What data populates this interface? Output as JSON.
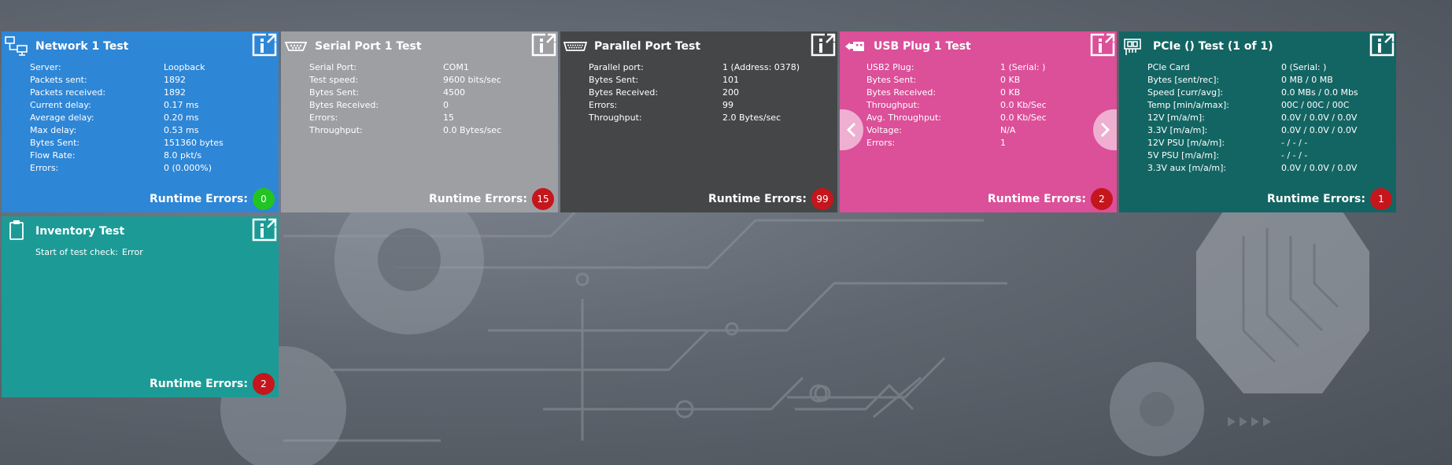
{
  "colors": {
    "network": "#2e86d6",
    "serial": "#9e9fa3",
    "parallel": "#454648",
    "usb": "#dc4f99",
    "pcie": "#136563",
    "inventory": "#1c9b96",
    "badge_green": "#22c421",
    "badge_red": "#c4161c"
  },
  "tiles": {
    "network": {
      "title": "Network 1 Test",
      "icon": "network-computers-icon",
      "rows": [
        {
          "k": "Server:",
          "v": "Loopback"
        },
        {
          "k": "Packets sent:",
          "v": "1892"
        },
        {
          "k": "Packets received:",
          "v": "1892"
        },
        {
          "k": "Current delay:",
          "v": "0.17 ms"
        },
        {
          "k": "Average delay:",
          "v": "0.20 ms"
        },
        {
          "k": "Max delay:",
          "v": "0.53 ms"
        },
        {
          "k": "Bytes Sent:",
          "v": "151360 bytes"
        },
        {
          "k": "Flow Rate:",
          "v": "8.0 pkt/s"
        },
        {
          "k": "Errors:",
          "v": "0 (0.000%)"
        }
      ],
      "runtime_label": "Runtime Errors:",
      "runtime_errors": "0"
    },
    "serial": {
      "title": "Serial Port 1 Test",
      "icon": "serial-port-icon",
      "rows": [
        {
          "k": "Serial Port:",
          "v": "COM1"
        },
        {
          "k": "Test speed:",
          "v": "9600 bits/sec"
        },
        {
          "k": "Bytes Sent:",
          "v": "4500"
        },
        {
          "k": "Bytes Received:",
          "v": "0"
        },
        {
          "k": "Errors:",
          "v": "15"
        },
        {
          "k": "Throughput:",
          "v": "0.0 Bytes/sec"
        }
      ],
      "runtime_label": "Runtime Errors:",
      "runtime_errors": "15"
    },
    "parallel": {
      "title": "Parallel Port Test",
      "icon": "parallel-port-icon",
      "rows": [
        {
          "k": "Parallel port:",
          "v": "1 (Address: 0378)"
        },
        {
          "k": "Bytes Sent:",
          "v": "101"
        },
        {
          "k": "Bytes Received:",
          "v": "200"
        },
        {
          "k": "Errors:",
          "v": "99"
        },
        {
          "k": "Throughput:",
          "v": "2.0 Bytes/sec"
        }
      ],
      "runtime_label": "Runtime Errors:",
      "runtime_errors": "99"
    },
    "usb": {
      "title": "USB Plug 1 Test",
      "icon": "usb-plug-icon",
      "rows": [
        {
          "k": "USB2 Plug:",
          "v": "1 (Serial: )"
        },
        {
          "k": "Bytes Sent:",
          "v": "0 KB"
        },
        {
          "k": "Bytes Received:",
          "v": "0 KB"
        },
        {
          "k": "Throughput:",
          "v": "0.0 Kb/Sec"
        },
        {
          "k": "Avg. Throughput:",
          "v": "0.0 Kb/Sec"
        },
        {
          "k": "Voltage:",
          "v": "N/A"
        },
        {
          "k": "Errors:",
          "v": "1"
        }
      ],
      "runtime_label": "Runtime Errors:",
      "runtime_errors": "2"
    },
    "pcie": {
      "title": "PCIe () Test (1 of 1)",
      "icon": "pcie-card-icon",
      "rows": [
        {
          "k": "PCIe Card",
          "v": "0 (Serial: )"
        },
        {
          "k": "Bytes [sent/rec]:",
          "v": "0 MB / 0 MB"
        },
        {
          "k": "Speed [curr/avg]:",
          "v": "0.0 MBs / 0.0 Mbs"
        },
        {
          "k": "Temp  [min/a/max]:",
          "v": "00C / 00C / 00C"
        },
        {
          "k": "12V [m/a/m]:",
          "v": "0.0V / 0.0V / 0.0V"
        },
        {
          "k": "3.3V [m/a/m]:",
          "v": "0.0V / 0.0V / 0.0V"
        },
        {
          "k": "12V PSU [m/a/m]:",
          "v": "- / - / -"
        },
        {
          "k": "5V PSU [m/a/m]:",
          "v": "- / - / -"
        },
        {
          "k": "3.3V aux [m/a/m]:",
          "v": "0.0V / 0.0V / 0.0V"
        }
      ],
      "runtime_label": "Runtime Errors:",
      "runtime_errors": "1"
    },
    "inventory": {
      "title": "Inventory Test",
      "icon": "clipboard-icon",
      "rows": [
        {
          "k": "Start of test check:",
          "v": "Error"
        }
      ],
      "runtime_label": "Runtime Errors:",
      "runtime_errors": "2"
    }
  }
}
